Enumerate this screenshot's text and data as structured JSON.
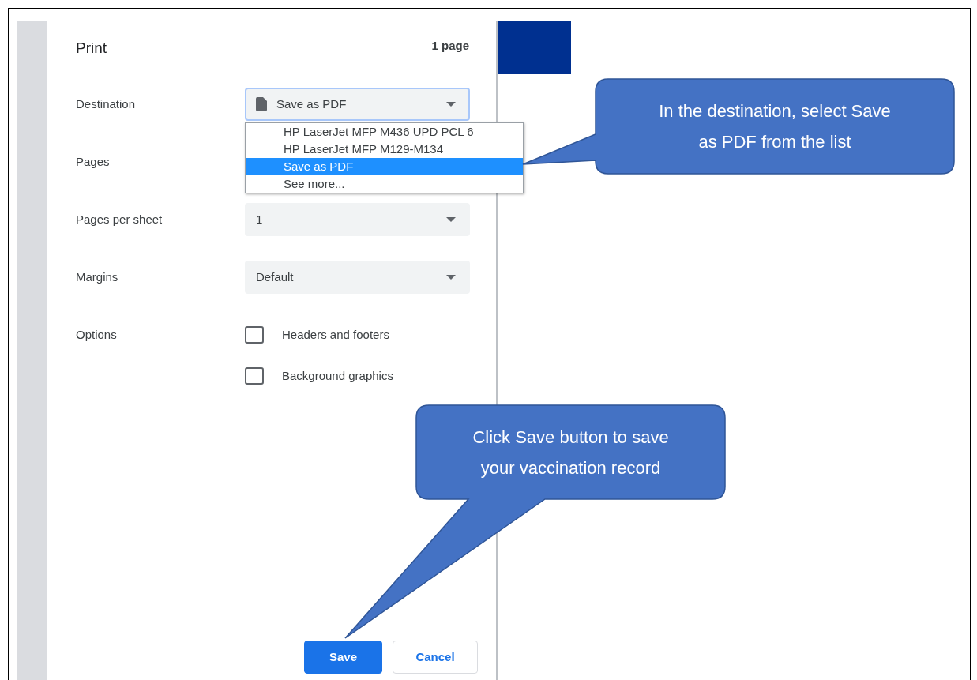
{
  "title": "Print",
  "page_count": "1 page",
  "destination": {
    "label": "Destination",
    "value": "Save as PDF",
    "focused": true
  },
  "destination_menu": [
    {
      "label": "HP LaserJet MFP M436 UPD PCL 6",
      "selected": false
    },
    {
      "label": "HP LaserJet MFP M129-M134",
      "selected": false
    },
    {
      "label": "Save as PDF",
      "selected": true
    },
    {
      "label": "See more...",
      "selected": false
    }
  ],
  "pages": {
    "label": "Pages"
  },
  "pages_per_sheet": {
    "label": "Pages per sheet",
    "value": "1"
  },
  "margins": {
    "label": "Margins",
    "value": "Default"
  },
  "options": {
    "label": "Options",
    "items": [
      {
        "label": "Headers and footers",
        "checked": false
      },
      {
        "label": "Background graphics",
        "checked": false
      }
    ]
  },
  "buttons": [
    {
      "label": "Save",
      "kind": "primary"
    },
    {
      "label": "Cancel",
      "kind": "secondary"
    }
  ],
  "callouts": [
    {
      "lines": [
        "In the destination, select Save",
        "as PDF from the list"
      ]
    },
    {
      "lines": [
        "Click Save button to save",
        "your vaccination record"
      ]
    }
  ]
}
